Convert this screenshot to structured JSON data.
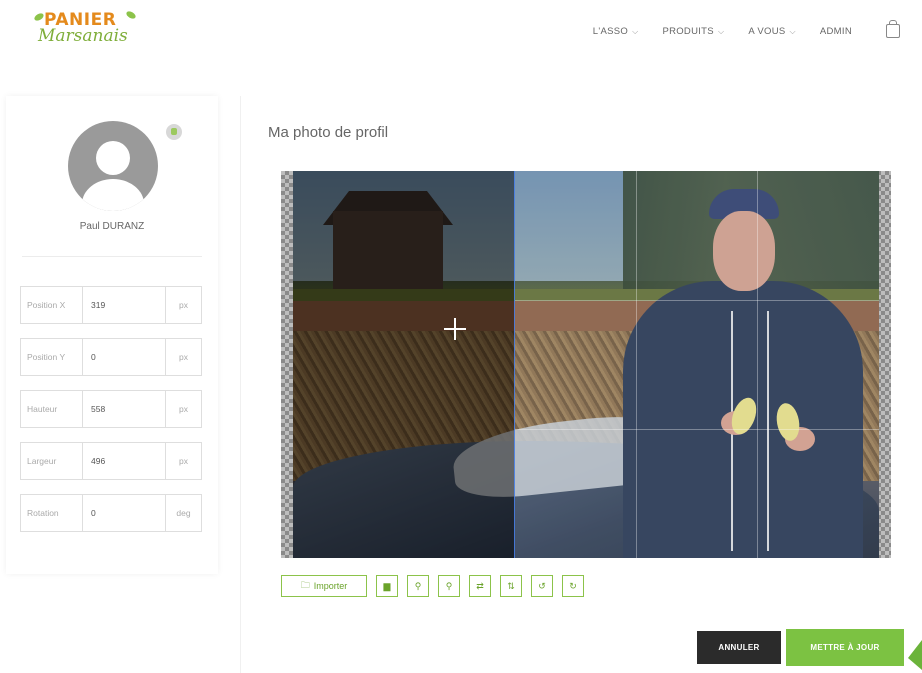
{
  "header": {
    "logo_top": "PANIER",
    "logo_bottom": "Marsanais",
    "nav": [
      {
        "label": "L'ASSO",
        "has_dropdown": true
      },
      {
        "label": "PRODUITS",
        "has_dropdown": true
      },
      {
        "label": "A VOUS",
        "has_dropdown": true
      },
      {
        "label": "ADMIN",
        "has_dropdown": false
      }
    ],
    "cart_icon": "shopping-bag-icon"
  },
  "profile": {
    "name": "Paul DURANZ",
    "fields": [
      {
        "label": "Position X",
        "value": "319",
        "unit": "px"
      },
      {
        "label": "Position Y",
        "value": "0",
        "unit": "px"
      },
      {
        "label": "Hauteur",
        "value": "558",
        "unit": "px"
      },
      {
        "label": "Largeur",
        "value": "496",
        "unit": "px"
      },
      {
        "label": "Rotation",
        "value": "0",
        "unit": "deg"
      }
    ]
  },
  "editor": {
    "title": "Ma photo de profil",
    "toolbar": [
      {
        "icon": "folder-icon",
        "label": "Importer"
      },
      {
        "icon": "image-icon",
        "label": ""
      },
      {
        "icon": "zoom-in-icon",
        "label": ""
      },
      {
        "icon": "zoom-out-icon",
        "label": ""
      },
      {
        "icon": "flip-horizontal-icon",
        "label": ""
      },
      {
        "icon": "flip-vertical-icon",
        "label": ""
      },
      {
        "icon": "rotate-left-icon",
        "label": ""
      },
      {
        "icon": "rotate-right-icon",
        "label": ""
      }
    ]
  },
  "actions": {
    "cancel": "ANNULER",
    "update": "METTRE À JOUR"
  },
  "colors": {
    "accent": "#7cc242",
    "dark_button": "#2b2b2b",
    "logo_orange": "#e48a1c"
  }
}
